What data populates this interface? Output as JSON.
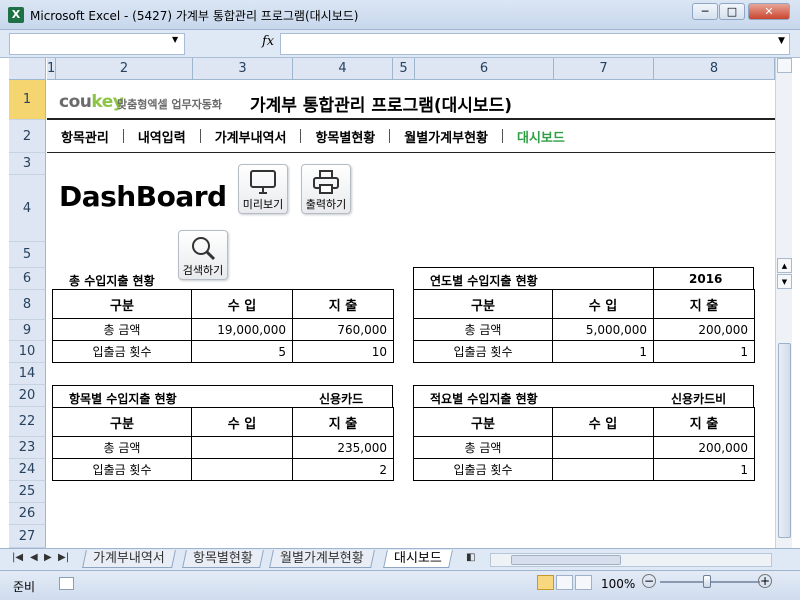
{
  "window": {
    "title": "Microsoft Excel - (5427) 가계부 통합관리 프로그램(대시보드)",
    "app_icon": "X",
    "min": "─",
    "restore": "□",
    "close": "✕"
  },
  "formula_bar": {
    "fx": "fx",
    "name_value": "",
    "formula_value": ""
  },
  "columns": [
    "1",
    "2",
    "3",
    "4",
    "5",
    "6",
    "7",
    "8"
  ],
  "rows": [
    "1",
    "2",
    "3",
    "4",
    "5",
    "6",
    "8",
    "9",
    "10",
    "14",
    "20",
    "22",
    "23",
    "24",
    "25",
    "26",
    "27"
  ],
  "brand": {
    "logo_main": "cou",
    "logo_accent": "key",
    "sub": "맞춤형엑셀 업무자동화",
    "program_title": "가계부 통합관리 프로그램(대시보드)"
  },
  "nav": [
    "항목관리",
    "내역입력",
    "가계부내역서",
    "항목별현황",
    "월별가계부현황",
    "대시보드"
  ],
  "dashboard_title": "DashBoard",
  "buttons": {
    "preview": "미리보기",
    "print": "출력하기",
    "search": "검색하기"
  },
  "panels": {
    "total": {
      "title": "총 수입지출 현황",
      "headers": [
        "구분",
        "수 입",
        "지 출"
      ],
      "rows": [
        [
          "총 금액",
          "19,000,000",
          "760,000"
        ],
        [
          "입출금 횟수",
          "5",
          "10"
        ]
      ]
    },
    "yearly": {
      "title": "연도별 수입지출 현황",
      "year": "2016",
      "headers": [
        "구분",
        "수 입",
        "지 출"
      ],
      "rows": [
        [
          "총 금액",
          "5,000,000",
          "200,000"
        ],
        [
          "입출금 횟수",
          "1",
          "1"
        ]
      ]
    },
    "item": {
      "title": "항목별 수입지출 현황",
      "selector": "신용카드",
      "headers": [
        "구분",
        "수 입",
        "지 출"
      ],
      "rows": [
        [
          "총 금액",
          "",
          "235,000"
        ],
        [
          "입출금 횟수",
          "",
          "2"
        ]
      ]
    },
    "memo": {
      "title": "적요별 수입지출 현황",
      "selector": "신용카드비",
      "headers": [
        "구분",
        "수 입",
        "지 출"
      ],
      "rows": [
        [
          "총 금액",
          "",
          "200,000"
        ],
        [
          "입출금 횟수",
          "",
          "1"
        ]
      ]
    }
  },
  "sheet_tabs": [
    "가계부내역서",
    "항목별현황",
    "월별가계부현황",
    "대시보드"
  ],
  "active_tab": "대시보드",
  "status": {
    "text": "준비",
    "zoom": "100%"
  }
}
